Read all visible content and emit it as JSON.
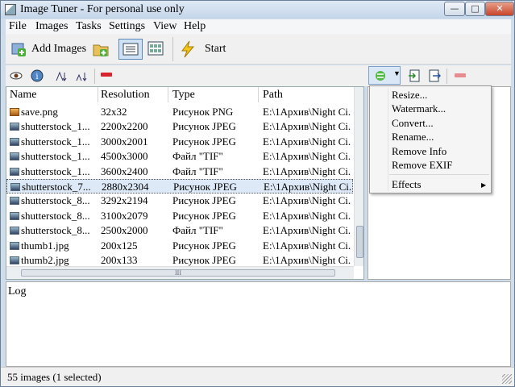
{
  "window": {
    "title": "Image Tuner - For personal use only",
    "min": "—",
    "max": "□",
    "close": "✕"
  },
  "menu": [
    "File",
    "Images",
    "Tasks",
    "Settings",
    "View",
    "Help"
  ],
  "toolbar": {
    "add_images": "Add Images",
    "start": "Start"
  },
  "columns": [
    "Name",
    "Resolution",
    "Type",
    "Path"
  ],
  "rows": [
    {
      "name": "save.png",
      "resolution": "32x32",
      "type": "Рисунок PNG",
      "path": "E:\\1Архив\\Night Ci.",
      "icon": "png"
    },
    {
      "name": "shutterstock_1...",
      "resolution": "2200x2200",
      "type": "Рисунок JPEG",
      "path": "E:\\1Архив\\Night Ci.",
      "icon": "jpg"
    },
    {
      "name": "shutterstock_1...",
      "resolution": "3000x2001",
      "type": "Рисунок JPEG",
      "path": "E:\\1Архив\\Night Ci.",
      "icon": "jpg"
    },
    {
      "name": "shutterstock_1...",
      "resolution": "4500x3000",
      "type": "Файл \"TIF\"",
      "path": "E:\\1Архив\\Night Ci.",
      "icon": "tif"
    },
    {
      "name": "shutterstock_1...",
      "resolution": "3600x2400",
      "type": "Файл \"TIF\"",
      "path": "E:\\1Архив\\Night Ci.",
      "icon": "tif"
    },
    {
      "name": "shutterstock_7...",
      "resolution": "2880x2304",
      "type": "Рисунок JPEG",
      "path": "E:\\1Архив\\Night Ci.",
      "icon": "jpg"
    },
    {
      "name": "shutterstock_8...",
      "resolution": "3292x2194",
      "type": "Рисунок JPEG",
      "path": "E:\\1Архив\\Night Ci.",
      "icon": "jpg"
    },
    {
      "name": "shutterstock_8...",
      "resolution": "3100x2079",
      "type": "Рисунок JPEG",
      "path": "E:\\1Архив\\Night Ci.",
      "icon": "jpg"
    },
    {
      "name": "shutterstock_8...",
      "resolution": "2500x2000",
      "type": "Файл \"TIF\"",
      "path": "E:\\1Архив\\Night Ci.",
      "icon": "tif"
    },
    {
      "name": "thumb1.jpg",
      "resolution": "200x125",
      "type": "Рисунок JPEG",
      "path": "E:\\1Архив\\Night Ci.",
      "icon": "jpg"
    },
    {
      "name": "thumb2.jpg",
      "resolution": "200x133",
      "type": "Рисунок JPEG",
      "path": "E:\\1Архив\\Night Ci.",
      "icon": "jpg"
    }
  ],
  "selected_row": 5,
  "context_menu": [
    "Resize...",
    "Watermark...",
    "Convert...",
    "Rename...",
    "Remove Info",
    "Remove EXIF",
    "Effects"
  ],
  "hscroll_grip": "III",
  "log_label": "Log",
  "status": "55 images (1 selected)",
  "colors": {
    "selection": "#dde9f7",
    "title_gradient": "#c5d6ea",
    "close_button": "#c8452a",
    "remove_icon": "#d9232d"
  }
}
